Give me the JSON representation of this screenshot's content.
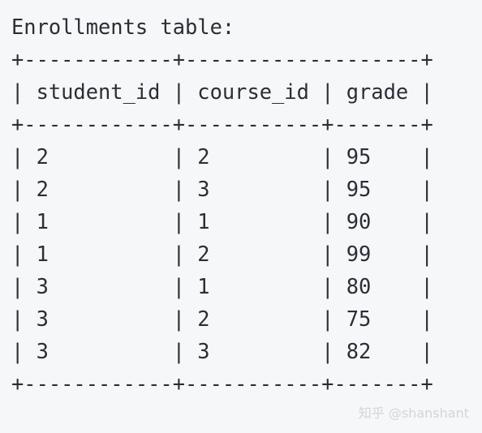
{
  "caption": "Enrollments table:",
  "table": {
    "border_top": "+------------+-------------------+",
    "header": "| student_id | course_id | grade |",
    "separator": "+------------+-----------+-------+",
    "columns": [
      "student_id",
      "course_id",
      "grade"
    ],
    "rows": [
      {
        "text": "| 2          | 2         | 95    |",
        "student_id": "2",
        "course_id": "2",
        "grade": "95"
      },
      {
        "text": "| 2          | 3         | 95    |",
        "student_id": "2",
        "course_id": "3",
        "grade": "95"
      },
      {
        "text": "| 1          | 1         | 90    |",
        "student_id": "1",
        "course_id": "1",
        "grade": "90"
      },
      {
        "text": "| 1          | 2         | 99    |",
        "student_id": "1",
        "course_id": "2",
        "grade": "99"
      },
      {
        "text": "| 3          | 1         | 80    |",
        "student_id": "3",
        "course_id": "1",
        "grade": "80"
      },
      {
        "text": "| 3          | 2         | 75    |",
        "student_id": "3",
        "course_id": "2",
        "grade": "75"
      },
      {
        "text": "| 3          | 3         | 82    |",
        "student_id": "3",
        "course_id": "3",
        "grade": "82"
      }
    ],
    "border_bottom": "+------------+-----------+-------+"
  },
  "watermark": "知乎 @shanshant"
}
